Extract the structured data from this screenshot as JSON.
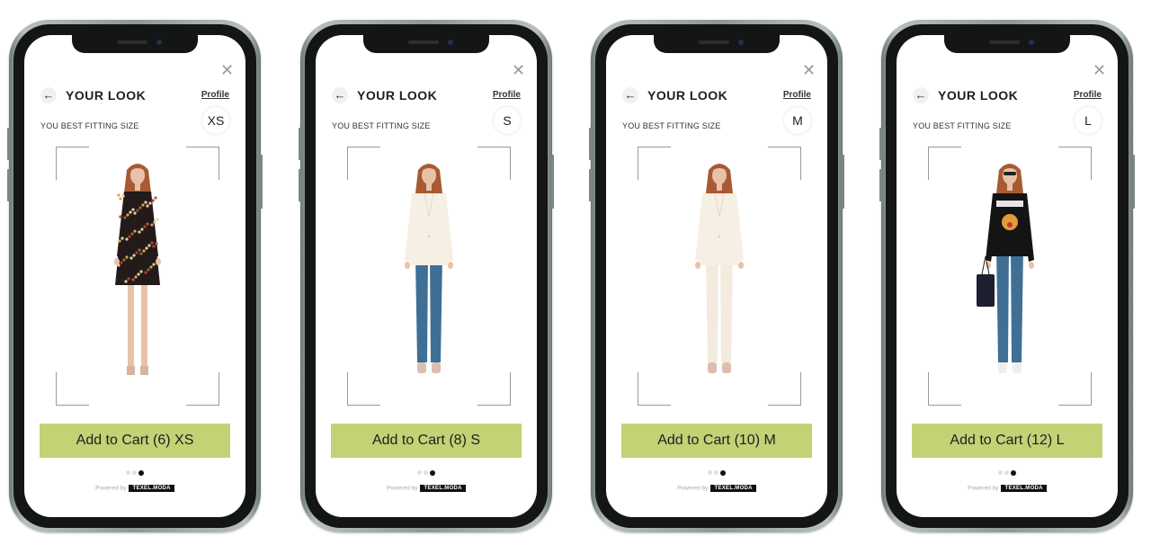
{
  "brand": {
    "accent_color": "#c4d175",
    "powered_by_label": "Powered by",
    "logo_text": "TEXEL.MODA"
  },
  "phones": [
    {
      "close_icon": "close-icon",
      "back_icon": "arrow-left-icon",
      "title": "YOUR LOOK",
      "profile_link": "Profile",
      "size_label": "YOU BEST FITTING SIZE",
      "size": "XS",
      "outfit": "floral-dress",
      "cart_button": "Add to Cart (6) XS",
      "pagination": {
        "total": 3,
        "active": 3
      }
    },
    {
      "close_icon": "close-icon",
      "back_icon": "arrow-left-icon",
      "title": "YOUR LOOK",
      "profile_link": "Profile",
      "size_label": "YOU BEST FITTING SIZE",
      "size": "S",
      "outfit": "white-blazer-blue-jeans",
      "cart_button": "Add to Cart (8) S",
      "pagination": {
        "total": 3,
        "active": 3
      }
    },
    {
      "close_icon": "close-icon",
      "back_icon": "arrow-left-icon",
      "title": "YOUR LOOK",
      "profile_link": "Profile",
      "size_label": "YOU BEST FITTING SIZE",
      "size": "M",
      "outfit": "white-pantsuit",
      "cart_button": "Add to Cart (10) M",
      "pagination": {
        "total": 3,
        "active": 3
      }
    },
    {
      "close_icon": "close-icon",
      "back_icon": "arrow-left-icon",
      "title": "YOUR LOOK",
      "profile_link": "Profile",
      "size_label": "YOU BEST FITTING SIZE",
      "size": "L",
      "outfit": "tiger-sweatshirt-jeans-tote",
      "cart_button": "Add to Cart (12) L",
      "pagination": {
        "total": 3,
        "active": 3
      }
    }
  ]
}
